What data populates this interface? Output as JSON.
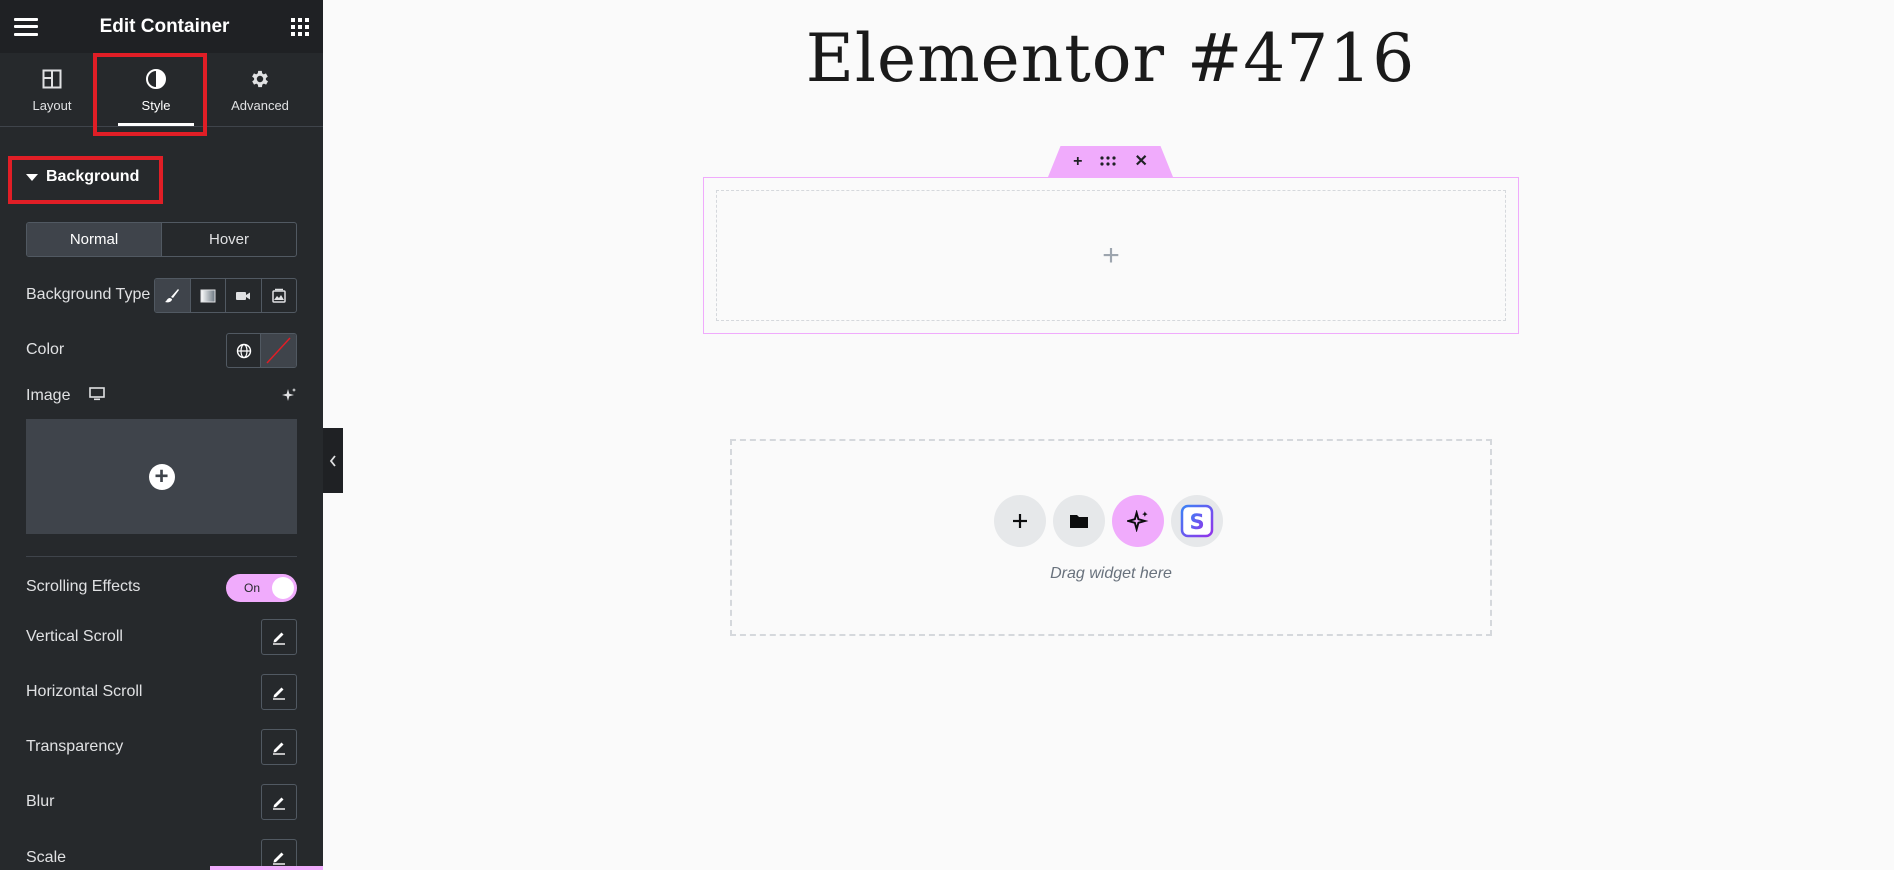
{
  "sidebar": {
    "header": {
      "title": "Edit Container",
      "menu_icon": "hamburger-icon",
      "apps_icon": "grid-icon"
    },
    "tabs": [
      {
        "label": "Layout",
        "icon": "layout-icon"
      },
      {
        "label": "Style",
        "icon": "contrast-icon",
        "active": true
      },
      {
        "label": "Advanced",
        "icon": "gear-icon"
      }
    ],
    "section": {
      "title": "Background"
    },
    "state_toggle": {
      "normal": "Normal",
      "hover": "Hover",
      "selected": "Normal"
    },
    "background_type": {
      "label": "Background Type",
      "options": [
        "classic-brush-icon",
        "gradient-icon",
        "video-icon",
        "slideshow-icon"
      ]
    },
    "color": {
      "label": "Color"
    },
    "image": {
      "label": "Image"
    },
    "scrolling_effects": {
      "label": "Scrolling Effects",
      "value": "On"
    },
    "effects": [
      {
        "label": "Vertical Scroll"
      },
      {
        "label": "Horizontal Scroll"
      },
      {
        "label": "Transparency"
      },
      {
        "label": "Blur"
      },
      {
        "label": "Scale"
      }
    ],
    "highlight_color": "#e01e26",
    "accent_color": "#f0abfc"
  },
  "canvas": {
    "page_title": "Elementor #4716",
    "drop_text": "Drag widget here"
  }
}
